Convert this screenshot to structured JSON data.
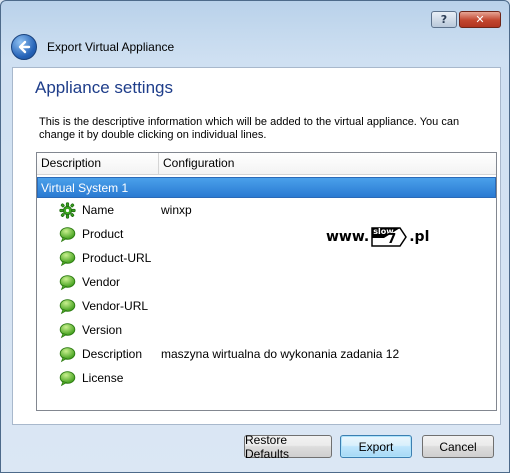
{
  "window": {
    "help_button": "?",
    "close_button": "✕"
  },
  "header": {
    "title": "Export Virtual Appliance"
  },
  "page": {
    "title": "Appliance settings",
    "description": "This is the descriptive information which will be added to the virtual appliance. You can change it by double clicking on individual lines."
  },
  "table": {
    "columns": [
      "Description",
      "Configuration"
    ],
    "group": "Virtual System 1",
    "rows": [
      {
        "label": "Name",
        "value": "winxp",
        "icon": "gear-icon"
      },
      {
        "label": "Product",
        "value": "",
        "icon": "speech-bubble-icon"
      },
      {
        "label": "Product-URL",
        "value": "",
        "icon": "speech-bubble-icon"
      },
      {
        "label": "Vendor",
        "value": "",
        "icon": "speech-bubble-icon"
      },
      {
        "label": "Vendor-URL",
        "value": "",
        "icon": "speech-bubble-icon"
      },
      {
        "label": "Version",
        "value": "",
        "icon": "speech-bubble-icon"
      },
      {
        "label": "Description",
        "value": "maszyna wirtualna do wykonania zadania 12",
        "icon": "speech-bubble-icon"
      },
      {
        "label": "License",
        "value": "",
        "icon": "speech-bubble-icon"
      }
    ]
  },
  "buttons": {
    "restore": "Restore Defaults",
    "export": "Export",
    "cancel": "Cancel"
  },
  "watermark": {
    "prefix": "www.",
    "badge_top": "slow",
    "badge_digit": "7",
    "suffix": ".pl"
  },
  "colors": {
    "accent": "#2a7ad2",
    "title_text": "#1e3d8a",
    "icon_green": "#3aa51f"
  }
}
